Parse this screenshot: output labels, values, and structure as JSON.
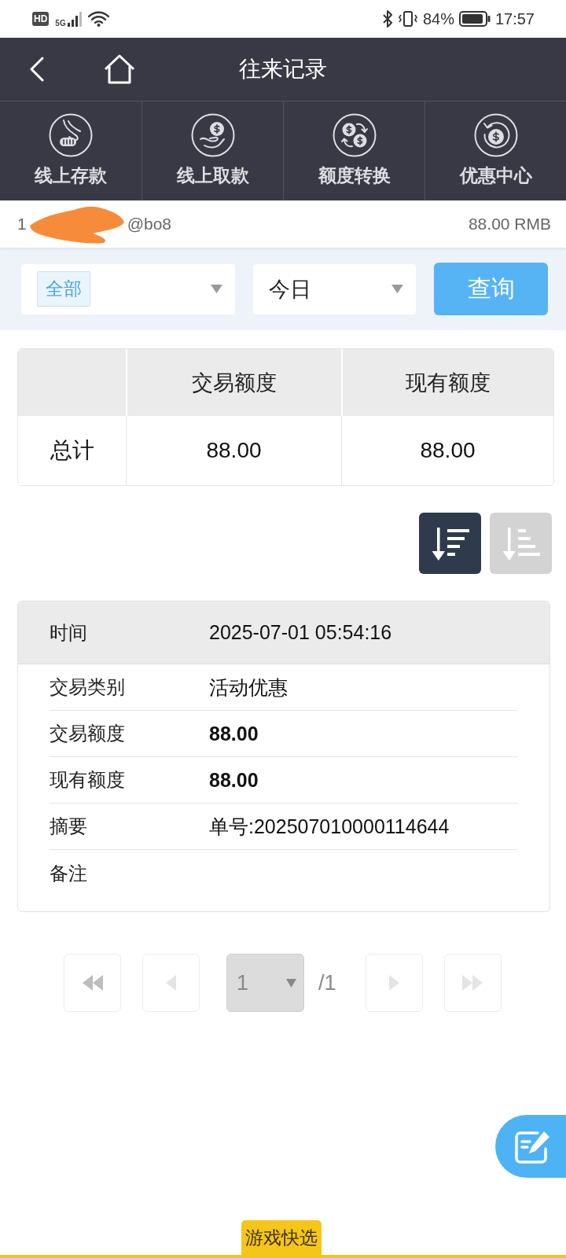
{
  "status_bar": {
    "network_badge": "HD",
    "network_type": "5G",
    "battery_percent": "84%",
    "time": "17:57"
  },
  "header": {
    "title": "往来记录"
  },
  "nav_items": [
    {
      "label": "线上存款"
    },
    {
      "label": "线上取款"
    },
    {
      "label": "额度转换"
    },
    {
      "label": "优惠中心"
    }
  ],
  "account": {
    "username_start": "1",
    "username_end": "@bo8",
    "balance": "88.00 RMB"
  },
  "filters": {
    "type_select": {
      "value": "全部"
    },
    "period_select": {
      "value": "今日"
    },
    "query_button": "查询"
  },
  "summary_table": {
    "columns": [
      "交易额度",
      "现有额度"
    ],
    "rows": [
      {
        "label": "总计",
        "cells": [
          "88.00",
          "88.00"
        ]
      }
    ]
  },
  "sort_buttons": [
    {
      "selected": true
    },
    {
      "selected": false
    }
  ],
  "record": {
    "header": {
      "label": "时间",
      "value": "2025-07-01 05:54:16"
    },
    "fields": [
      {
        "kind": "text",
        "label": "交易类别",
        "value": "活动优惠"
      },
      {
        "kind": "amount",
        "label": "交易额度",
        "value": "88.00"
      },
      {
        "kind": "amount",
        "label": "现有额度",
        "value": "88.00"
      },
      {
        "kind": "text",
        "label": "摘要",
        "value": "单号:202507010000114644"
      },
      {
        "kind": "text",
        "label": "备注"
      }
    ]
  },
  "pagination": {
    "back_buttons": [
      {
        "disabled": false
      },
      {
        "disabled": true
      }
    ],
    "page_select": {
      "value": "1"
    },
    "total": "/1",
    "forward_buttons": [
      {
        "disabled": true
      },
      {
        "disabled": true
      }
    ]
  },
  "bottom_tab": {
    "label": "游戏快选"
  }
}
